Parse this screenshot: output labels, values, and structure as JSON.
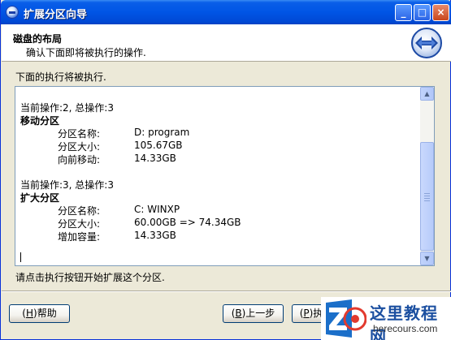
{
  "window": {
    "title": "扩展分区向导"
  },
  "titlebar_buttons": {
    "minimize": "_",
    "maximize": "□",
    "close": "×"
  },
  "header": {
    "title": "磁盘的布局",
    "subtitle": "确认下面即将被执行的操作."
  },
  "intro_text": "下面的执行将被执行.",
  "operations": [
    {
      "header": "当前操作:2, 总操作:3",
      "title": "移动分区",
      "fields": [
        {
          "label": "分区名称:",
          "value": "D: program"
        },
        {
          "label": "分区大小:",
          "value": "105.67GB"
        },
        {
          "label": "向前移动:",
          "value": "14.33GB"
        }
      ]
    },
    {
      "header": "当前操作:3, 总操作:3",
      "title": "扩大分区",
      "fields": [
        {
          "label": "分区名称:",
          "value": "C: WINXP"
        },
        {
          "label": "分区大小:",
          "value": "60.00GB => 74.34GB"
        },
        {
          "label": "增加容量:",
          "value": "14.33GB"
        }
      ]
    }
  ],
  "scrollbar": {
    "up_arrow": "▲",
    "down_arrow": "▼"
  },
  "status_text": "请点击执行按钮开始扩展这个分区.",
  "buttons": {
    "help": {
      "prefix": "(",
      "hotkey": "H",
      "suffix": ")帮助"
    },
    "back": {
      "prefix": "(",
      "hotkey": "B",
      "suffix": ")上一步"
    },
    "next": {
      "prefix": "(",
      "hotkey": "P",
      "suffix": ")执"
    }
  },
  "watermark": {
    "title": "这里教程网",
    "url": "herecours.com"
  },
  "colors": {
    "titlebar": "#0055e5",
    "dialog_bg": "#ece9d8",
    "watermark_blue": "#1b4fa0"
  }
}
